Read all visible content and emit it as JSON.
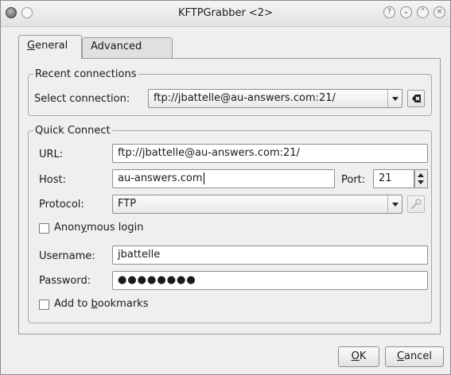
{
  "window": {
    "title": "KFTPGrabber <2>"
  },
  "window_buttons": [
    "help-icon",
    "minimize-icon",
    "maximize-icon",
    "close-icon"
  ],
  "tabs": {
    "general": {
      "pre": "",
      "mnemonic": "G",
      "post": "eneral"
    },
    "advanced": "Advanced"
  },
  "recent": {
    "legend": "Recent connections",
    "select_label": "Select connection:",
    "selected": "ftp://jbattelle@au-answers.com:21/"
  },
  "quick": {
    "legend": "Quick Connect",
    "url_label": "URL:",
    "url_value": "ftp://jbattelle@au-answers.com:21/",
    "host_label": "Host:",
    "host_value": "au-answers.com",
    "port_label": "Port:",
    "port_value": "21",
    "protocol_label": "Protocol:",
    "protocol_value": "FTP",
    "anon": {
      "pre": "Anon",
      "mnemonic": "y",
      "post": "mous login",
      "checked": false
    },
    "username_label": "Username:",
    "username_value": "jbattelle",
    "password_label": "Password:",
    "password_value": "●●●●●●●●",
    "bookmark": {
      "pre": "Add to ",
      "mnemonic": "b",
      "post": "ookmarks",
      "checked": false
    }
  },
  "buttons": {
    "ok": {
      "pre": "",
      "mnemonic": "O",
      "post": "K"
    },
    "cancel": {
      "pre": "",
      "mnemonic": "C",
      "post": "ancel"
    }
  }
}
